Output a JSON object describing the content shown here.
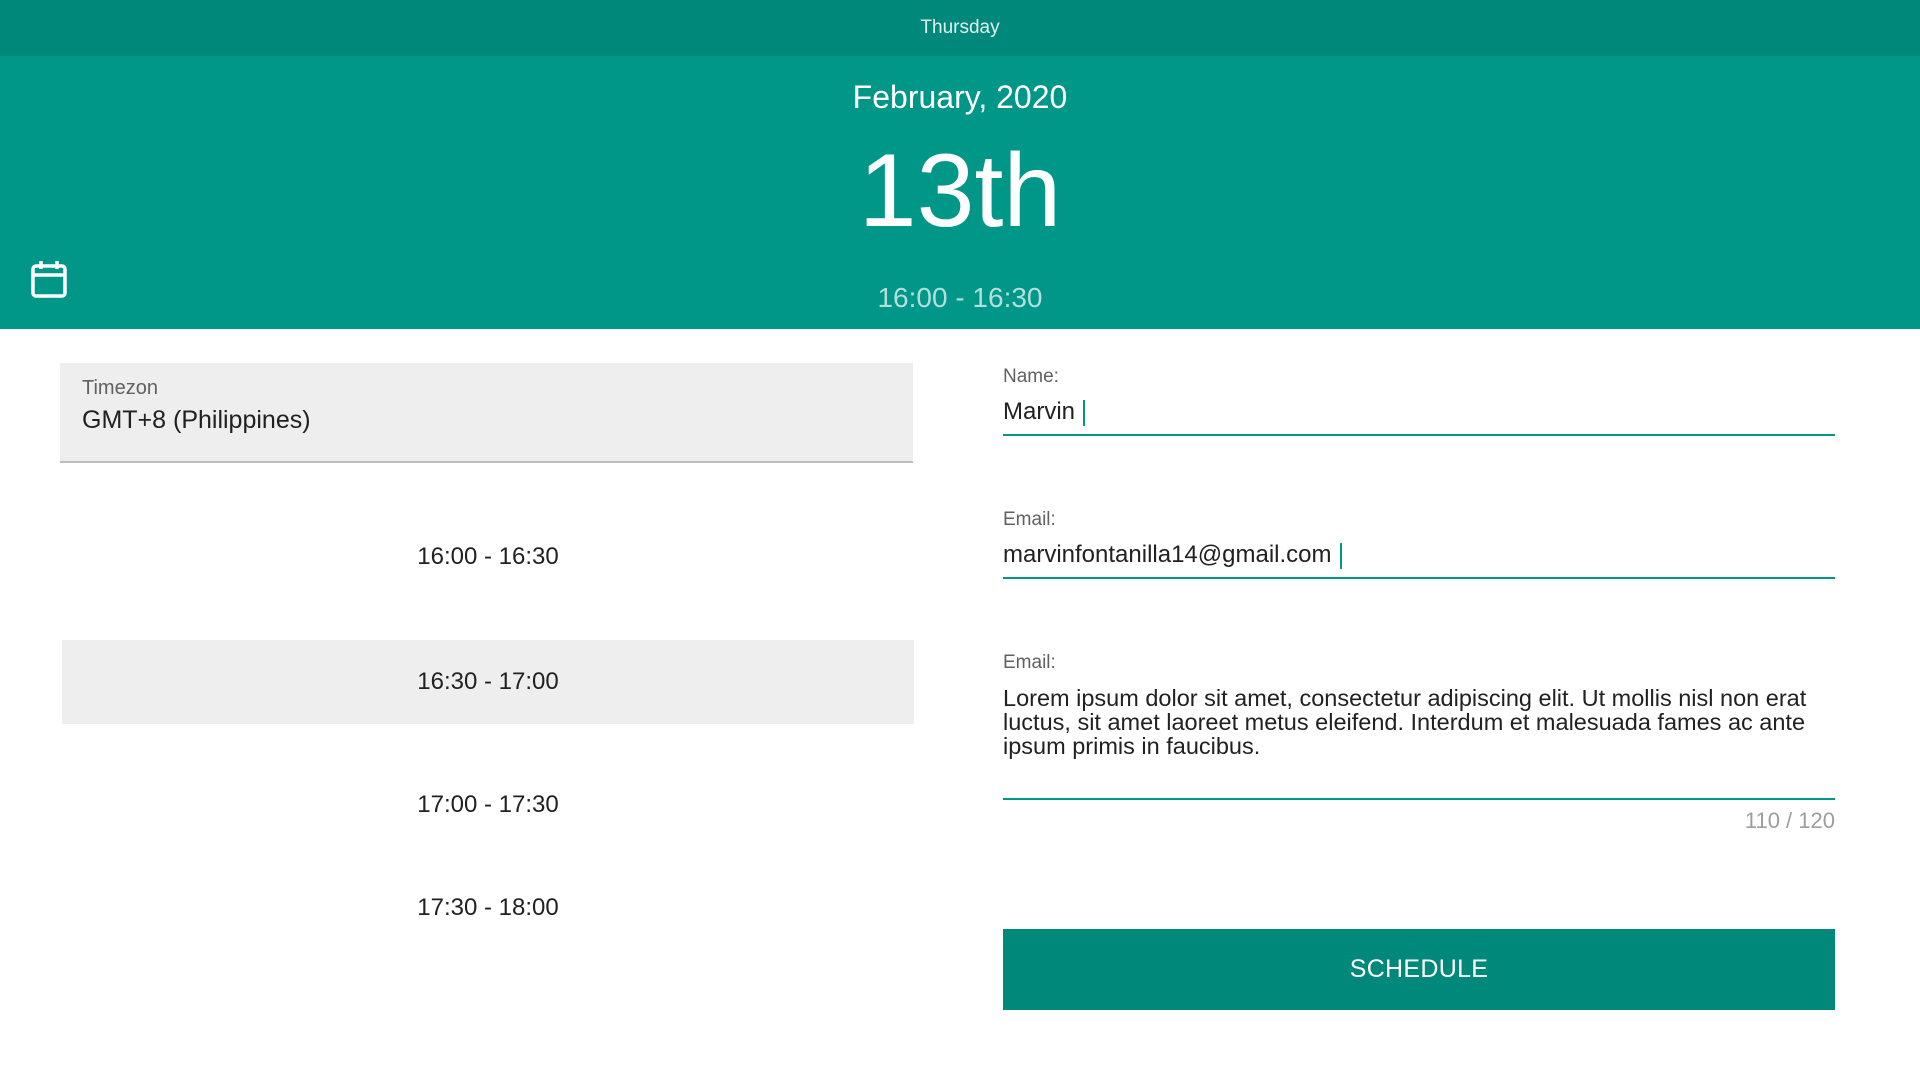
{
  "header": {
    "weekday": "Thursday",
    "month_year": "February, 2020",
    "day": "13th",
    "selected_range": "16:00 - 16:30",
    "calendar_icon": "calendar-icon"
  },
  "timezone": {
    "label": "Timezon",
    "value": "GMT+8 (Philippines)"
  },
  "slots": [
    {
      "label": "16:00 - 16:30",
      "selected": false
    },
    {
      "label": "16:30 - 17:00",
      "selected": true
    },
    {
      "label": "17:00 - 17:30",
      "selected": false
    },
    {
      "label": "17:30 - 18:00",
      "selected": false
    }
  ],
  "form": {
    "name_label": "Name:",
    "name_value": "Marvin",
    "email_label": "Email:",
    "email_value": "marvinfontanilla14@gmail.com",
    "message_label": "Email:",
    "message_value": "Lorem ipsum dolor sit amet, consectetur adipiscing elit. Ut mollis nisl non erat luctus, sit amet laoreet metus eleifend. Interdum et malesuada fames ac ante ipsum primis in faucibus.",
    "message_counter": "110 / 120",
    "submit_label": "SCHEDULE"
  },
  "colors": {
    "accent": "#009688",
    "accent_dark": "#00897b",
    "selected_bg": "#eeeeee"
  }
}
